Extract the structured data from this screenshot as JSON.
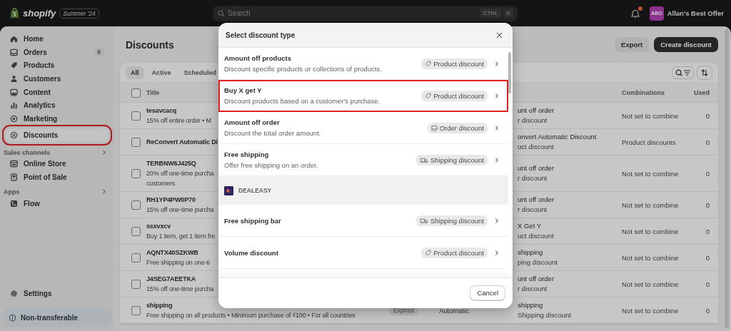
{
  "top_bar": {
    "logo": "shopify",
    "edition": "Summer '24",
    "search": {
      "placeholder": "Search",
      "shortcut": [
        "CTRL",
        "K"
      ]
    },
    "notifications": {
      "unread": true
    },
    "store": {
      "initials": "ABO",
      "name": "Allan's Best Offer"
    }
  },
  "sidebar": {
    "items": [
      {
        "kind": "home",
        "label": "Home",
        "selected": false,
        "annotated": false
      },
      {
        "kind": "orders",
        "label": "Orders",
        "count": "6",
        "selected": false,
        "annotated": false
      },
      {
        "kind": "products",
        "label": "Products",
        "selected": false,
        "annotated": false
      },
      {
        "kind": "customers",
        "label": "Customers",
        "selected": false,
        "annotated": false
      },
      {
        "kind": "content",
        "label": "Content",
        "selected": false,
        "annotated": false
      },
      {
        "kind": "analytics",
        "label": "Analytics",
        "selected": false,
        "annotated": false
      },
      {
        "kind": "marketing",
        "label": "Marketing",
        "selected": false,
        "annotated": false
      },
      {
        "kind": "discounts",
        "label": "Discounts",
        "selected": true,
        "annotated": true
      }
    ],
    "sections": [
      {
        "title": "Sales channels",
        "items": [
          {
            "kind": "store",
            "label": "Online Store",
            "selected": false,
            "annotated": false
          },
          {
            "kind": "pos",
            "label": "Point of Sale",
            "selected": false,
            "annotated": false
          }
        ]
      },
      {
        "title": "Apps",
        "items": [
          {
            "kind": "flow",
            "label": "Flow",
            "selected": false,
            "annotated": false
          }
        ]
      }
    ],
    "settings": {
      "label": "Settings"
    },
    "footer": {
      "label": "Non-transferable"
    }
  },
  "page": {
    "title": "Discounts",
    "actions": [
      {
        "label": "Export",
        "kind": "secondary"
      },
      {
        "label": "Create discount",
        "kind": "primary"
      }
    ],
    "tabs": [
      {
        "label": "All",
        "selected": true
      },
      {
        "label": "Active",
        "selected": false
      },
      {
        "label": "Scheduled",
        "selected": false
      }
    ],
    "table": {
      "header_checked": false,
      "columns": [
        "Title",
        "Combinations",
        "Used"
      ],
      "rows": [
        {
          "checked": false,
          "title": "tesavcacq",
          "details": [
            "15% off entire order • M"
          ],
          "type": [
            "unt off order",
            "r discount"
          ],
          "combinations": "Not set to combine",
          "used": "0"
        },
        {
          "checked": false,
          "title": "ReConvert Automatic Di",
          "type": [
            "onvert Automatic Discount",
            "uct discount"
          ],
          "combinations": "Product discounts",
          "used": "0"
        },
        {
          "checked": false,
          "title": "TERBNW6J425Q",
          "details": [
            "20% off one-time purcha",
            "customers"
          ],
          "type": [
            "unt off order",
            "r discount"
          ],
          "combinations": "Not set to combine",
          "used": "0"
        },
        {
          "checked": false,
          "title": "RH1YP4PW0P70",
          "details": [
            "15% off one-time purcha"
          ],
          "type": [
            "unt off order",
            "r discount"
          ],
          "combinations": "Not set to combine",
          "used": "0"
        },
        {
          "checked": false,
          "title": "ssxvxcv",
          "details": [
            "Buy 1 item, get 1 item fre"
          ],
          "type": [
            "X Get Y",
            "uct discount"
          ],
          "combinations": "Not set to combine",
          "used": "0"
        },
        {
          "checked": false,
          "title": "AQNTX40SZKWB",
          "details": [
            "Free shipping on one-ti"
          ],
          "type": [
            "shipping",
            "ping discount"
          ],
          "combinations": "Not set to combine",
          "used": "0"
        },
        {
          "checked": false,
          "title": "J4SEG7AEETKA",
          "details": [
            "15% off one-time purcha"
          ],
          "type": [
            "unt off order",
            "r discount"
          ],
          "combinations": "Not set to combine",
          "used": "0"
        },
        {
          "checked": false,
          "title": "shipping",
          "details": [
            "Free shipping on all products • Minimum purchase of ₫100 • For all countries"
          ],
          "status": "Expired",
          "method": "Automatic",
          "type": [
            "shipping",
            "Shipping discount"
          ],
          "combinations": "Not set to combine",
          "used": "0"
        }
      ]
    }
  },
  "modal": {
    "title": "Select discount type",
    "options": [
      {
        "kind": "option",
        "title": "Amount off products",
        "description": "Discount specific products or collections of products.",
        "badge": {
          "kind": "product",
          "label": "Product discount"
        },
        "annotated": false
      },
      {
        "kind": "option",
        "title": "Buy X get Y",
        "description": "Discount products based on a customer's purchase.",
        "badge": {
          "kind": "product",
          "label": "Product discount"
        },
        "annotated": true
      },
      {
        "kind": "option",
        "title": "Amount off order",
        "description": "Discount the total order amount.",
        "badge": {
          "kind": "order",
          "label": "Order discount"
        },
        "annotated": false
      },
      {
        "kind": "option",
        "title": "Free shipping",
        "description": "Offer free shipping on an order.",
        "badge": {
          "kind": "shipping",
          "label": "Shipping discount"
        },
        "annotated": false
      },
      {
        "kind": "app",
        "title": "DEALEASY"
      },
      {
        "kind": "option",
        "title": "Free shipping bar",
        "badge": {
          "kind": "shipping",
          "label": "Shipping discount"
        },
        "annotated": false
      },
      {
        "kind": "option",
        "title": "Volume discount",
        "badge": {
          "kind": "product",
          "label": "Product discount"
        },
        "annotated": false
      }
    ],
    "buttons": [
      {
        "label": "Cancel"
      }
    ]
  }
}
